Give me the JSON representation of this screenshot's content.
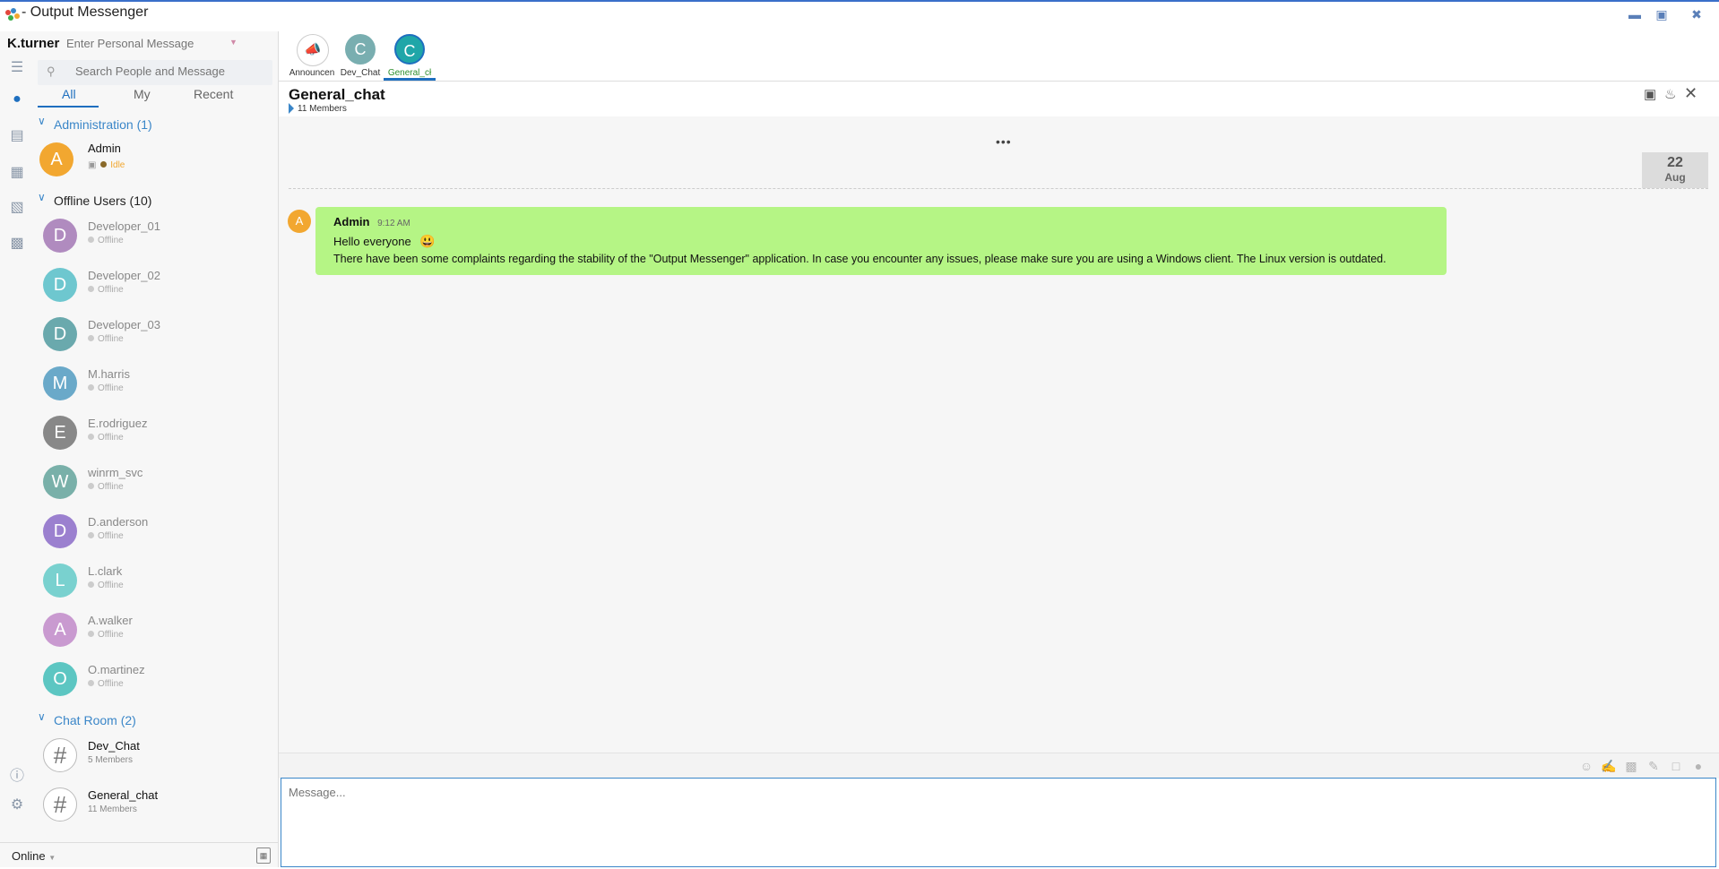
{
  "window": {
    "title": "- Output Messenger",
    "controls": [
      "minimize",
      "restore",
      "close"
    ]
  },
  "user": {
    "name": "K.turner",
    "personal_message_placeholder": "Enter Personal Message",
    "presence": "Online"
  },
  "search": {
    "placeholder": "Search People and Message"
  },
  "tabs": [
    "All",
    "My",
    "Recent"
  ],
  "groups": {
    "administration": {
      "label": "Administration (1)",
      "contacts": [
        {
          "name": "Admin",
          "initial": "A",
          "status": "Idle",
          "color": "#f2a730"
        }
      ]
    },
    "offline": {
      "label": "Offline Users (10)",
      "contacts": [
        {
          "name": "Developer_01",
          "initial": "D",
          "status": "Offline",
          "color": "#b08bbf"
        },
        {
          "name": "Developer_02",
          "initial": "D",
          "status": "Offline",
          "color": "#6ec7cf"
        },
        {
          "name": "Developer_03",
          "initial": "D",
          "status": "Offline",
          "color": "#6aa9ad"
        },
        {
          "name": "M.harris",
          "initial": "M",
          "status": "Offline",
          "color": "#6aa9c9"
        },
        {
          "name": "E.rodriguez",
          "initial": "E",
          "status": "Offline",
          "color": "#888888"
        },
        {
          "name": "winrm_svc",
          "initial": "W",
          "status": "Offline",
          "color": "#79b0a9"
        },
        {
          "name": "D.anderson",
          "initial": "D",
          "status": "Offline",
          "color": "#9b80cf"
        },
        {
          "name": "L.clark",
          "initial": "L",
          "status": "Offline",
          "color": "#79d1cf"
        },
        {
          "name": "A.walker",
          "initial": "A",
          "status": "Offline",
          "color": "#c99ad0"
        },
        {
          "name": "O.martinez",
          "initial": "O",
          "status": "Offline",
          "color": "#5cc6c2"
        }
      ]
    },
    "chatrooms": {
      "label": "Chat Room (2)",
      "rooms": [
        {
          "name": "Dev_Chat",
          "members": "5 Members"
        },
        {
          "name": "General_chat",
          "members": "11 Members"
        }
      ]
    }
  },
  "chat_tabs": [
    {
      "label": "Announcen",
      "initial": "",
      "color": "#ffffff"
    },
    {
      "label": "Dev_Chat",
      "initial": "C",
      "color": "#79aeb0"
    },
    {
      "label": "General_cł",
      "initial": "C",
      "color": "#1fa6a8"
    }
  ],
  "conversation": {
    "title": "General_chat",
    "members": "11 Members",
    "date_day": "22",
    "date_month": "Aug",
    "messages": [
      {
        "author": "Admin",
        "initial": "A",
        "time": "9:12 AM",
        "line1": "Hello everyone",
        "emoji": "😃",
        "line2": "There have been some complaints regarding the stability of the \"Output Messenger\" application. In case you encounter any issues, please make sure you are using a Windows client. The Linux version is outdated."
      }
    ]
  },
  "composer": {
    "placeholder": "Message..."
  },
  "colors": {
    "accent": "#1e6fbf",
    "bubble": "#b5f585",
    "idle": "#f2a730"
  }
}
